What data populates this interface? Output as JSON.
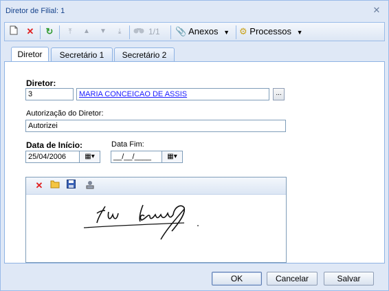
{
  "window": {
    "title": "Diretor de Filial: 1"
  },
  "toolbar": {
    "record_position": "1/1",
    "attachments_label": "Anexos",
    "processes_label": "Processos"
  },
  "tabs": [
    "Diretor",
    "Secretário 1",
    "Secretário 2"
  ],
  "form": {
    "director_label": "Diretor:",
    "director_code": "3",
    "director_name": "MARIA CONCEICAO DE ASSIS",
    "lookup_button": "...",
    "authorization_label": "Autorização do Diretor:",
    "authorization_value": "Autorizei",
    "start_date_label": "Data de Início:",
    "start_date_value": "25/04/2006",
    "end_date_label": "Data Fim:",
    "end_date_value": "__/__/____"
  },
  "footer": {
    "ok": "OK",
    "cancel": "Cancelar",
    "save": "Salvar"
  },
  "colors": {
    "accent": "#15428b",
    "border": "#99bbe8",
    "delete_red": "#e02020",
    "link": "#1a1aff"
  }
}
